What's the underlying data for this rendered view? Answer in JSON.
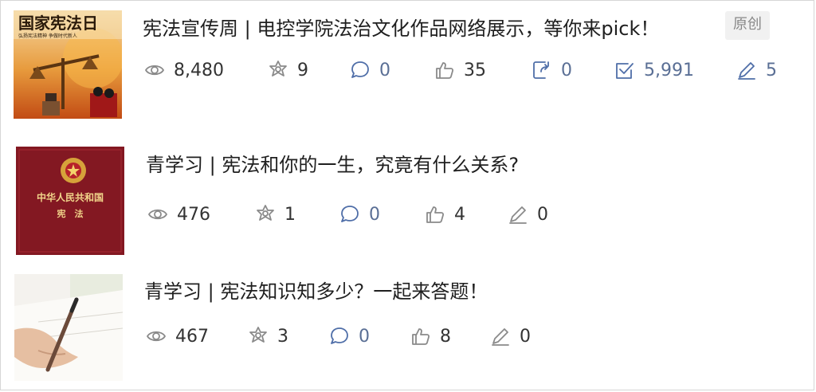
{
  "articles": [
    {
      "title": "宪法宣传周 | 电控学院法治文化作品网络展示，等你来pick！",
      "badge": "原创",
      "thumb_text_main": "国家宪法日",
      "thumb_text_sub": "弘扬宪法精神 争做时代新人",
      "stats": {
        "views": "8,480",
        "shares": "9",
        "comments": "0",
        "likes": "35",
        "forwards": "0",
        "reads": "5,991",
        "edits": "5"
      }
    },
    {
      "title": "青学习 | 宪法和你的一生，究竟有什么关系?",
      "thumb_text_main": "中华人民共和国",
      "thumb_text_sub": "宪　法",
      "stats": {
        "views": "476",
        "shares": "1",
        "comments": "0",
        "likes": "4",
        "edits": "0"
      }
    },
    {
      "title": "青学习 | 宪法知识知多少？一起来答题！",
      "stats": {
        "views": "467",
        "shares": "3",
        "comments": "0",
        "likes": "8",
        "edits": "0"
      }
    }
  ],
  "colors": {
    "accent_blue": "#4f6ea8",
    "icon_grey": "#8a8a8a",
    "badge_bg": "#f1f1f1"
  }
}
